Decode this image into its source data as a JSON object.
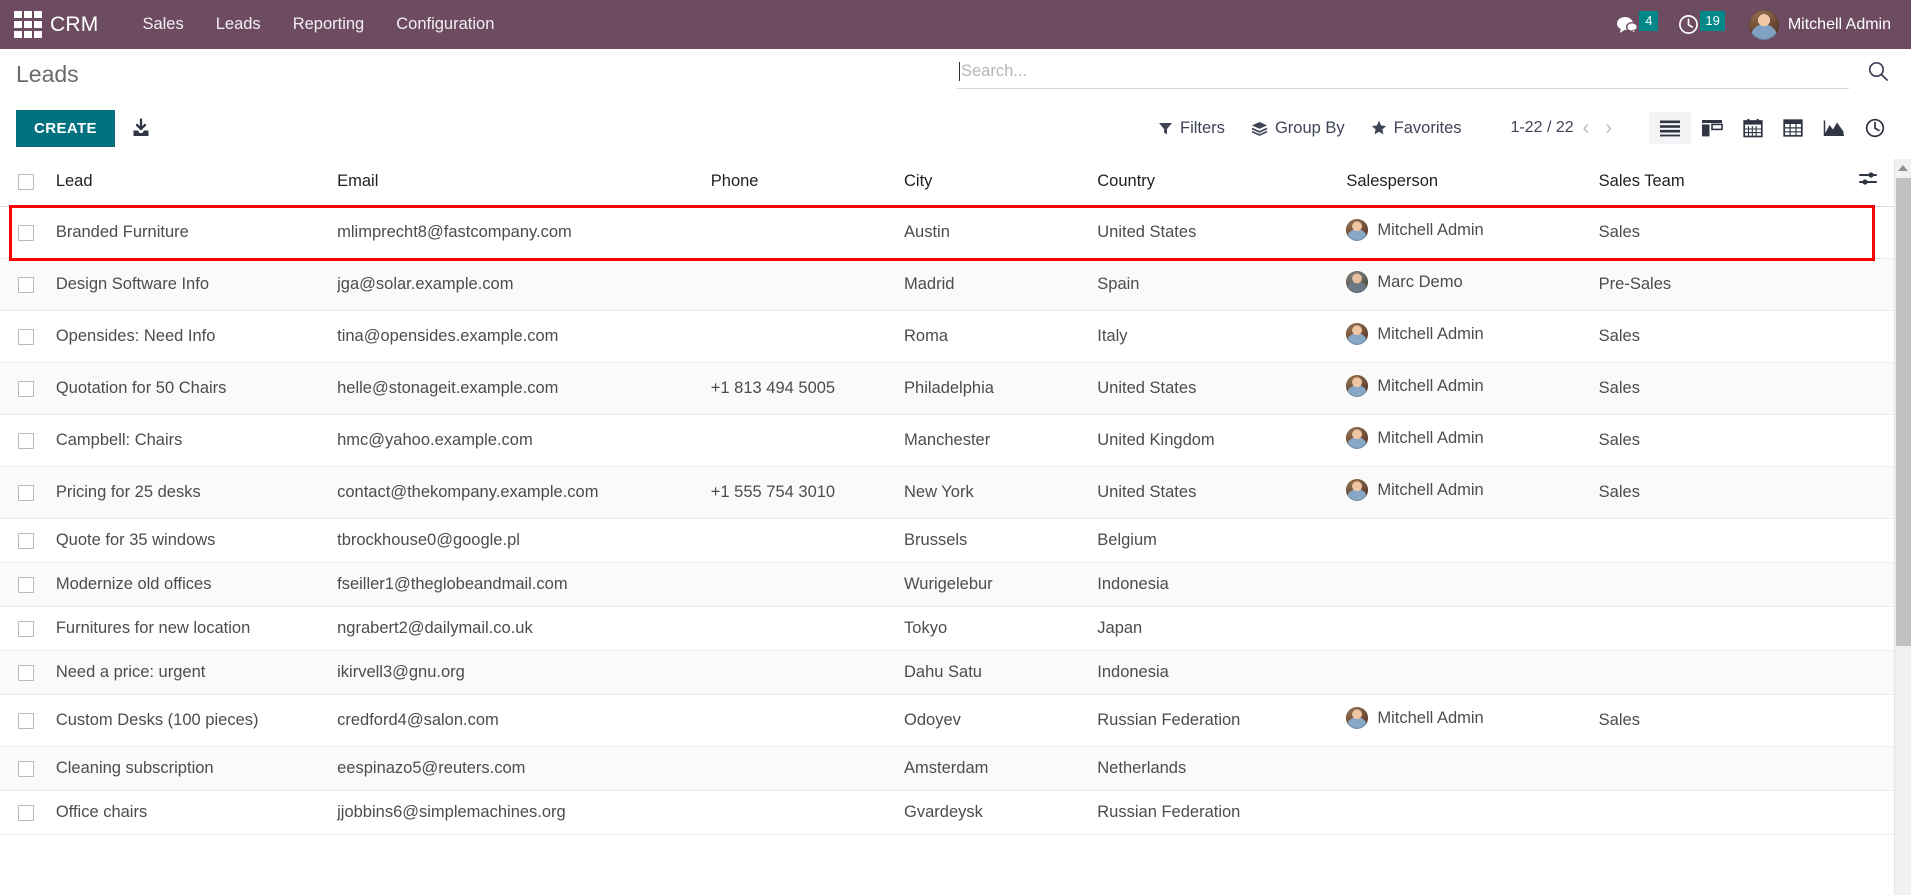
{
  "navbar": {
    "apps_icon": "apps-grid-icon",
    "brand": "CRM",
    "menu": [
      {
        "label": "Sales"
      },
      {
        "label": "Leads"
      },
      {
        "label": "Reporting"
      },
      {
        "label": "Configuration"
      }
    ],
    "messages": {
      "icon": "messages-icon",
      "count": "4"
    },
    "activities": {
      "icon": "clock-icon",
      "count": "19"
    },
    "user": {
      "name": "Mitchell Admin",
      "avatar": "user-avatar"
    }
  },
  "control_panel": {
    "title": "Leads",
    "create_label": "CREATE",
    "import_icon": "import-download-icon",
    "search": {
      "placeholder": "Search...",
      "value": ""
    },
    "search_icon": "search-magnifier-icon",
    "filters_label": "Filters",
    "groupby_label": "Group By",
    "favorites_label": "Favorites",
    "pager": {
      "text": "1-22 / 22",
      "prev": "‹",
      "next": "›"
    },
    "views": [
      {
        "name": "list-view",
        "label": "List",
        "active": true
      },
      {
        "name": "kanban-view",
        "label": "Kanban",
        "active": false
      },
      {
        "name": "calendar-view",
        "label": "Calendar",
        "active": false
      },
      {
        "name": "pivot-view",
        "label": "Pivot",
        "active": false
      },
      {
        "name": "graph-view",
        "label": "Graph",
        "active": false
      },
      {
        "name": "activity-view",
        "label": "Activity",
        "active": false
      }
    ]
  },
  "table": {
    "headers": {
      "lead": "Lead",
      "email": "Email",
      "phone": "Phone",
      "city": "City",
      "country": "Country",
      "salesperson": "Salesperson",
      "sales_team": "Sales Team",
      "options_icon": "column-options-icon"
    },
    "rows": [
      {
        "lead": "Branded Furniture",
        "email": "mlimprecht8@fastcompany.com",
        "phone": "",
        "city": "Austin",
        "country": "United States",
        "salesperson": "Mitchell Admin",
        "avatar": "av-mitchell",
        "team": "Sales",
        "highlighted": true
      },
      {
        "lead": "Design Software Info",
        "email": "jga@solar.example.com",
        "phone": "",
        "city": "Madrid",
        "country": "Spain",
        "salesperson": "Marc Demo",
        "avatar": "av-marc",
        "team": "Pre-Sales",
        "highlighted": false
      },
      {
        "lead": "Opensides: Need Info",
        "email": "tina@opensides.example.com",
        "phone": "",
        "city": "Roma",
        "country": "Italy",
        "salesperson": "Mitchell Admin",
        "avatar": "av-mitchell",
        "team": "Sales",
        "highlighted": false
      },
      {
        "lead": "Quotation for 50 Chairs",
        "email": "helle@stonageit.example.com",
        "phone": "+1 813 494 5005",
        "city": "Philadelphia",
        "country": "United States",
        "salesperson": "Mitchell Admin",
        "avatar": "av-mitchell",
        "team": "Sales",
        "highlighted": false
      },
      {
        "lead": "Campbell: Chairs",
        "email": "hmc@yahoo.example.com",
        "phone": "",
        "city": "Manchester",
        "country": "United Kingdom",
        "salesperson": "Mitchell Admin",
        "avatar": "av-mitchell",
        "team": "Sales",
        "highlighted": false
      },
      {
        "lead": "Pricing for 25 desks",
        "email": "contact@thekompany.example.com",
        "phone": "+1 555 754 3010",
        "city": "New York",
        "country": "United States",
        "salesperson": "Mitchell Admin",
        "avatar": "av-mitchell",
        "team": "Sales",
        "highlighted": false
      },
      {
        "lead": "Quote for 35 windows",
        "email": "tbrockhouse0@google.pl",
        "phone": "",
        "city": "Brussels",
        "country": "Belgium",
        "salesperson": "",
        "avatar": "",
        "team": "",
        "highlighted": false
      },
      {
        "lead": "Modernize old offices",
        "email": "fseiller1@theglobeandmail.com",
        "phone": "",
        "city": "Wurigelebur",
        "country": "Indonesia",
        "salesperson": "",
        "avatar": "",
        "team": "",
        "highlighted": false
      },
      {
        "lead": "Furnitures for new location",
        "email": "ngrabert2@dailymail.co.uk",
        "phone": "",
        "city": "Tokyo",
        "country": "Japan",
        "salesperson": "",
        "avatar": "",
        "team": "",
        "highlighted": false
      },
      {
        "lead": "Need a price: urgent",
        "email": "ikirvell3@gnu.org",
        "phone": "",
        "city": "Dahu Satu",
        "country": "Indonesia",
        "salesperson": "",
        "avatar": "",
        "team": "",
        "highlighted": false
      },
      {
        "lead": "Custom Desks (100 pieces)",
        "email": "credford4@salon.com",
        "phone": "",
        "city": "Odoyev",
        "country": "Russian Federation",
        "salesperson": "Mitchell Admin",
        "avatar": "av-mitchell",
        "team": "Sales",
        "highlighted": false
      },
      {
        "lead": "Cleaning subscription",
        "email": "eespinazo5@reuters.com",
        "phone": "",
        "city": "Amsterdam",
        "country": "Netherlands",
        "salesperson": "",
        "avatar": "",
        "team": "",
        "highlighted": false
      },
      {
        "lead": "Office chairs",
        "email": "jjobbins6@simplemachines.org",
        "phone": "",
        "city": "Gvardeysk",
        "country": "Russian Federation",
        "salesperson": "",
        "avatar": "",
        "team": "",
        "highlighted": false
      }
    ]
  },
  "colors": {
    "navbar_bg": "#6d4c61",
    "accent_teal": "#00717f",
    "badge_teal": "#00878a",
    "highlight_red": "#ff0000",
    "text": "#4c4c4c"
  }
}
